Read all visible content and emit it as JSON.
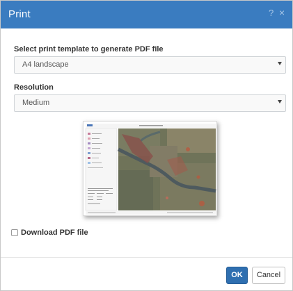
{
  "dialog": {
    "title": "Print",
    "help_icon": "question-icon",
    "close_icon": "close-icon"
  },
  "template": {
    "label": "Select print template to generate PDF file",
    "selected": "A4 landscape"
  },
  "resolution": {
    "label": "Resolution",
    "selected": "Medium"
  },
  "download": {
    "label": "Download PDF file",
    "checked": false
  },
  "buttons": {
    "ok": "OK",
    "cancel": "Cancel"
  },
  "colors": {
    "titlebar": "#3a7cc0",
    "primary_button": "#2f6fb0"
  }
}
